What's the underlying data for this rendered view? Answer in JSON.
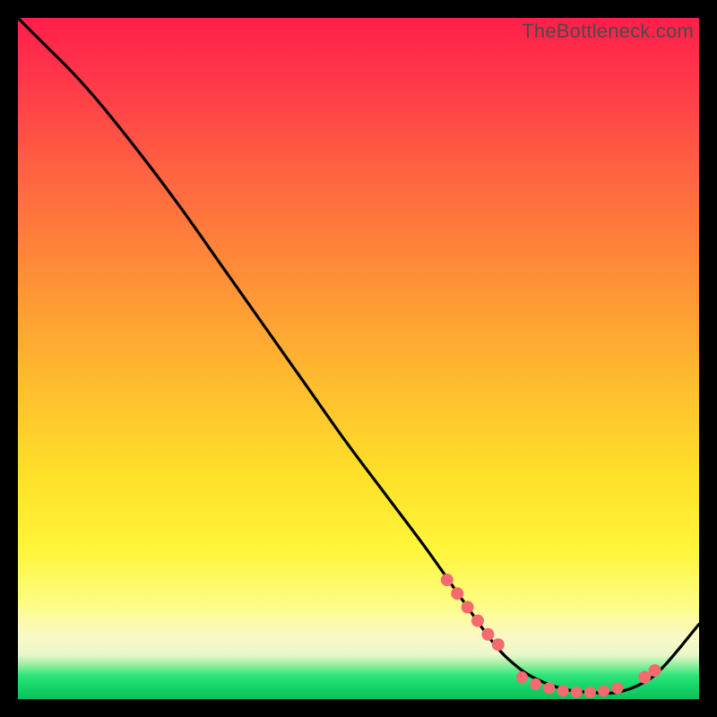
{
  "watermark": "TheBottleneck.com",
  "colors": {
    "curve_stroke": "#000000",
    "marker_fill": "#f46a6e",
    "marker_stroke": "#e85a5e"
  },
  "chart_data": {
    "type": "line",
    "title": "",
    "xlabel": "",
    "ylabel": "",
    "xlim": [
      0,
      100
    ],
    "ylim": [
      0,
      100
    ],
    "x": [
      0,
      4,
      8,
      12,
      18,
      24,
      30,
      36,
      42,
      48,
      54,
      60,
      66,
      70,
      73,
      76,
      80,
      84,
      88,
      92,
      95,
      100
    ],
    "y": [
      100,
      96,
      92,
      87.5,
      80,
      72,
      63.5,
      55,
      46.5,
      38,
      30,
      22,
      13.5,
      8,
      5,
      3,
      1.5,
      1,
      1,
      2.5,
      5,
      11
    ],
    "markers": {
      "left_cluster_x": [
        63,
        64.5,
        66,
        67.5,
        69,
        70.5
      ],
      "left_cluster_y": [
        17.5,
        15.5,
        13.5,
        11.5,
        9.5,
        8
      ],
      "valley_x": [
        74,
        76,
        78,
        80,
        82,
        84,
        86,
        88
      ],
      "valley_y": [
        3.2,
        2.2,
        1.6,
        1.2,
        1.0,
        1.0,
        1.2,
        1.6
      ],
      "right_x": [
        92,
        93.5
      ],
      "right_y": [
        3.2,
        4.2
      ]
    }
  }
}
